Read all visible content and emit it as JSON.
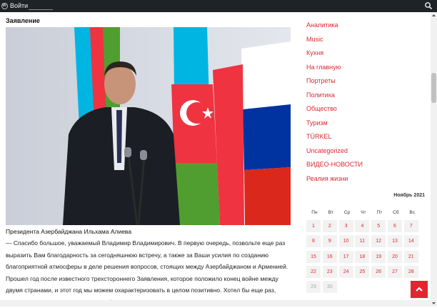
{
  "adminbar": {
    "login": "Войти"
  },
  "post": {
    "title": "Заявление",
    "caption": "Президента Азербайджана Ильхама Алиева",
    "body": "— Спасибо большое, уважаемый Владимир Владимирович. В первую очередь, позвольте еще раз выразить Вам благодарность за сегодняшнюю встречу, а также за Ваши усилия по созданию благоприятной атмосферы в деле решения вопросов, стоящих между Азербайджаном и Арменией. Прошел год после известного трехстороннего Заявления, которое положило конец войне между двумя странами, и этот год мы можем охарактеризовать в целом позитивно. Хотел бы еще раз, пользуясь возможностью, выразить благодарность, Владимир Владимирович, Вам,"
  },
  "sidebar": {
    "categories": [
      "Аналитика",
      "Music",
      "Кухня",
      "На главную",
      "Портреты",
      "Политика",
      "Общество",
      "Туризм",
      "TÜRKEL",
      "Uncategorized",
      "ВИДЕО-НОВОСТИ",
      "Реалия жизни"
    ]
  },
  "calendar": {
    "caption": "Ноябрь 2021",
    "weekdays": [
      "Пн",
      "Вт",
      "Ср",
      "Чт",
      "Пт",
      "Сб",
      "Вс"
    ],
    "weeks": [
      [
        "1",
        "2",
        "3",
        "4",
        "5",
        "6",
        "7"
      ],
      [
        "8",
        "9",
        "10",
        "11",
        "12",
        "13",
        "14"
      ],
      [
        "15",
        "16",
        "17",
        "18",
        "19",
        "20",
        "21"
      ],
      [
        "22",
        "23",
        "24",
        "25",
        "26",
        "27",
        "28"
      ],
      [
        "29",
        "30",
        "",
        "",
        "",
        "",
        ""
      ]
    ]
  },
  "colors": {
    "accent": "#e0272f",
    "adminbar": "#1d2327"
  },
  "icons": {
    "logo": "wordpress-icon",
    "search": "search-icon",
    "to_top": "arrow-up-icon"
  }
}
